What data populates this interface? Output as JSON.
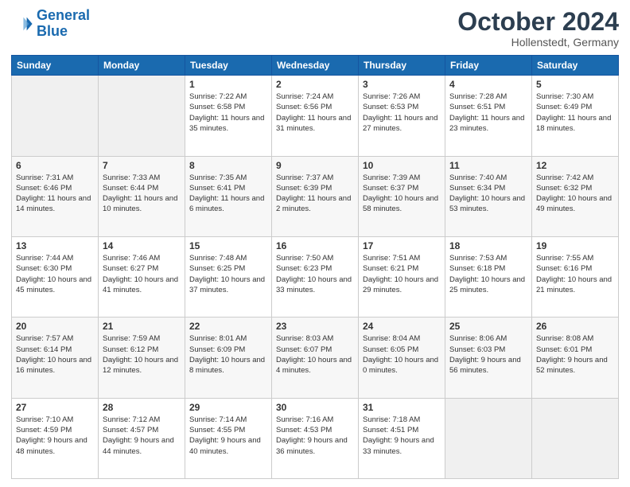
{
  "header": {
    "logo_line1": "General",
    "logo_line2": "Blue",
    "month": "October 2024",
    "location": "Hollenstedt, Germany"
  },
  "weekdays": [
    "Sunday",
    "Monday",
    "Tuesday",
    "Wednesday",
    "Thursday",
    "Friday",
    "Saturday"
  ],
  "weeks": [
    [
      {
        "day": "",
        "sunrise": "",
        "sunset": "",
        "daylight": ""
      },
      {
        "day": "",
        "sunrise": "",
        "sunset": "",
        "daylight": ""
      },
      {
        "day": "1",
        "sunrise": "Sunrise: 7:22 AM",
        "sunset": "Sunset: 6:58 PM",
        "daylight": "Daylight: 11 hours and 35 minutes."
      },
      {
        "day": "2",
        "sunrise": "Sunrise: 7:24 AM",
        "sunset": "Sunset: 6:56 PM",
        "daylight": "Daylight: 11 hours and 31 minutes."
      },
      {
        "day": "3",
        "sunrise": "Sunrise: 7:26 AM",
        "sunset": "Sunset: 6:53 PM",
        "daylight": "Daylight: 11 hours and 27 minutes."
      },
      {
        "day": "4",
        "sunrise": "Sunrise: 7:28 AM",
        "sunset": "Sunset: 6:51 PM",
        "daylight": "Daylight: 11 hours and 23 minutes."
      },
      {
        "day": "5",
        "sunrise": "Sunrise: 7:30 AM",
        "sunset": "Sunset: 6:49 PM",
        "daylight": "Daylight: 11 hours and 18 minutes."
      }
    ],
    [
      {
        "day": "6",
        "sunrise": "Sunrise: 7:31 AM",
        "sunset": "Sunset: 6:46 PM",
        "daylight": "Daylight: 11 hours and 14 minutes."
      },
      {
        "day": "7",
        "sunrise": "Sunrise: 7:33 AM",
        "sunset": "Sunset: 6:44 PM",
        "daylight": "Daylight: 11 hours and 10 minutes."
      },
      {
        "day": "8",
        "sunrise": "Sunrise: 7:35 AM",
        "sunset": "Sunset: 6:41 PM",
        "daylight": "Daylight: 11 hours and 6 minutes."
      },
      {
        "day": "9",
        "sunrise": "Sunrise: 7:37 AM",
        "sunset": "Sunset: 6:39 PM",
        "daylight": "Daylight: 11 hours and 2 minutes."
      },
      {
        "day": "10",
        "sunrise": "Sunrise: 7:39 AM",
        "sunset": "Sunset: 6:37 PM",
        "daylight": "Daylight: 10 hours and 58 minutes."
      },
      {
        "day": "11",
        "sunrise": "Sunrise: 7:40 AM",
        "sunset": "Sunset: 6:34 PM",
        "daylight": "Daylight: 10 hours and 53 minutes."
      },
      {
        "day": "12",
        "sunrise": "Sunrise: 7:42 AM",
        "sunset": "Sunset: 6:32 PM",
        "daylight": "Daylight: 10 hours and 49 minutes."
      }
    ],
    [
      {
        "day": "13",
        "sunrise": "Sunrise: 7:44 AM",
        "sunset": "Sunset: 6:30 PM",
        "daylight": "Daylight: 10 hours and 45 minutes."
      },
      {
        "day": "14",
        "sunrise": "Sunrise: 7:46 AM",
        "sunset": "Sunset: 6:27 PM",
        "daylight": "Daylight: 10 hours and 41 minutes."
      },
      {
        "day": "15",
        "sunrise": "Sunrise: 7:48 AM",
        "sunset": "Sunset: 6:25 PM",
        "daylight": "Daylight: 10 hours and 37 minutes."
      },
      {
        "day": "16",
        "sunrise": "Sunrise: 7:50 AM",
        "sunset": "Sunset: 6:23 PM",
        "daylight": "Daylight: 10 hours and 33 minutes."
      },
      {
        "day": "17",
        "sunrise": "Sunrise: 7:51 AM",
        "sunset": "Sunset: 6:21 PM",
        "daylight": "Daylight: 10 hours and 29 minutes."
      },
      {
        "day": "18",
        "sunrise": "Sunrise: 7:53 AM",
        "sunset": "Sunset: 6:18 PM",
        "daylight": "Daylight: 10 hours and 25 minutes."
      },
      {
        "day": "19",
        "sunrise": "Sunrise: 7:55 AM",
        "sunset": "Sunset: 6:16 PM",
        "daylight": "Daylight: 10 hours and 21 minutes."
      }
    ],
    [
      {
        "day": "20",
        "sunrise": "Sunrise: 7:57 AM",
        "sunset": "Sunset: 6:14 PM",
        "daylight": "Daylight: 10 hours and 16 minutes."
      },
      {
        "day": "21",
        "sunrise": "Sunrise: 7:59 AM",
        "sunset": "Sunset: 6:12 PM",
        "daylight": "Daylight: 10 hours and 12 minutes."
      },
      {
        "day": "22",
        "sunrise": "Sunrise: 8:01 AM",
        "sunset": "Sunset: 6:09 PM",
        "daylight": "Daylight: 10 hours and 8 minutes."
      },
      {
        "day": "23",
        "sunrise": "Sunrise: 8:03 AM",
        "sunset": "Sunset: 6:07 PM",
        "daylight": "Daylight: 10 hours and 4 minutes."
      },
      {
        "day": "24",
        "sunrise": "Sunrise: 8:04 AM",
        "sunset": "Sunset: 6:05 PM",
        "daylight": "Daylight: 10 hours and 0 minutes."
      },
      {
        "day": "25",
        "sunrise": "Sunrise: 8:06 AM",
        "sunset": "Sunset: 6:03 PM",
        "daylight": "Daylight: 9 hours and 56 minutes."
      },
      {
        "day": "26",
        "sunrise": "Sunrise: 8:08 AM",
        "sunset": "Sunset: 6:01 PM",
        "daylight": "Daylight: 9 hours and 52 minutes."
      }
    ],
    [
      {
        "day": "27",
        "sunrise": "Sunrise: 7:10 AM",
        "sunset": "Sunset: 4:59 PM",
        "daylight": "Daylight: 9 hours and 48 minutes."
      },
      {
        "day": "28",
        "sunrise": "Sunrise: 7:12 AM",
        "sunset": "Sunset: 4:57 PM",
        "daylight": "Daylight: 9 hours and 44 minutes."
      },
      {
        "day": "29",
        "sunrise": "Sunrise: 7:14 AM",
        "sunset": "Sunset: 4:55 PM",
        "daylight": "Daylight: 9 hours and 40 minutes."
      },
      {
        "day": "30",
        "sunrise": "Sunrise: 7:16 AM",
        "sunset": "Sunset: 4:53 PM",
        "daylight": "Daylight: 9 hours and 36 minutes."
      },
      {
        "day": "31",
        "sunrise": "Sunrise: 7:18 AM",
        "sunset": "Sunset: 4:51 PM",
        "daylight": "Daylight: 9 hours and 33 minutes."
      },
      {
        "day": "",
        "sunrise": "",
        "sunset": "",
        "daylight": ""
      },
      {
        "day": "",
        "sunrise": "",
        "sunset": "",
        "daylight": ""
      }
    ]
  ]
}
